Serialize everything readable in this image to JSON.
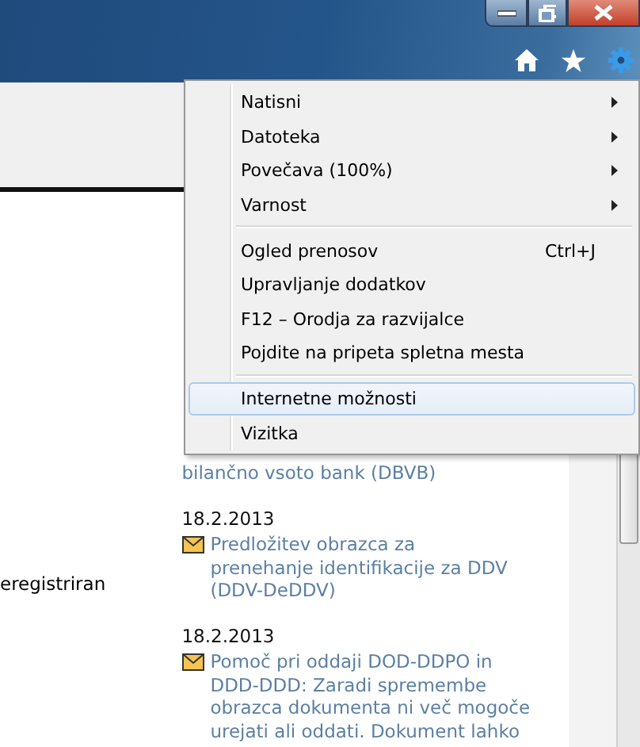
{
  "menu": {
    "items": [
      {
        "kind": "item",
        "label": "Natisni",
        "submenu": true,
        "selected": false
      },
      {
        "kind": "item",
        "label": "Datoteka",
        "submenu": true,
        "selected": false
      },
      {
        "kind": "item",
        "label": "Povečava (100%)",
        "submenu": true,
        "selected": false
      },
      {
        "kind": "item",
        "label": "Varnost",
        "submenu": true,
        "selected": false
      },
      {
        "kind": "separator"
      },
      {
        "kind": "item",
        "label": "Ogled prenosov",
        "shortcut": "Ctrl+J",
        "submenu": false,
        "selected": false
      },
      {
        "kind": "item",
        "label": "Upravljanje dodatkov",
        "submenu": false,
        "selected": false
      },
      {
        "kind": "item",
        "label": "F12 – Orodja za razvijalce",
        "submenu": false,
        "selected": false
      },
      {
        "kind": "item",
        "label": "Pojdite na pripeta spletna mesta",
        "submenu": false,
        "selected": false
      },
      {
        "kind": "separator"
      },
      {
        "kind": "item",
        "label": "Internetne možnosti",
        "submenu": false,
        "selected": true
      },
      {
        "kind": "item",
        "label": "Vizitka",
        "submenu": false,
        "selected": false
      }
    ]
  },
  "content": {
    "left_text": "eregistriran",
    "news": [
      {
        "mail": false,
        "title_lines": [
          "bilančno vsoto bank (DBVB)"
        ]
      },
      {
        "date": "18.2.2013",
        "mail": true,
        "title_lines": [
          "Predložitev obrazca za",
          "prenehanje identifikacije za DDV",
          "(DDV-DeDDV)"
        ]
      },
      {
        "date": "18.2.2013",
        "mail": true,
        "title_lines": [
          "Pomoč pri oddaji DOD-DDPO in",
          "DDD-DDD: Zaradi spremembe",
          "obrazca dokumenta ni več mogoče",
          "urejati ali oddati. Dokument lahko"
        ]
      }
    ]
  }
}
